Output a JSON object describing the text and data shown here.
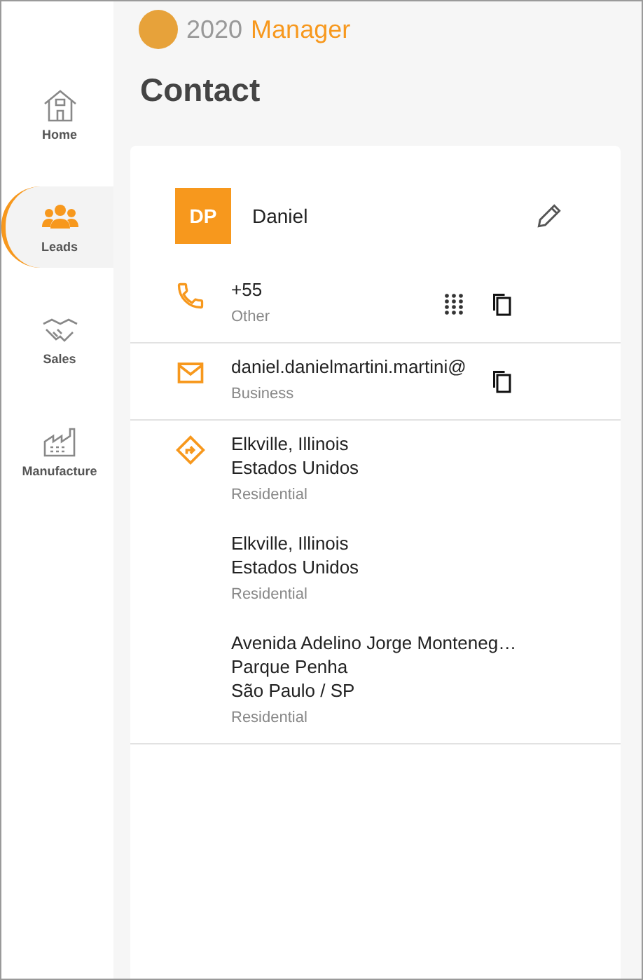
{
  "logo": {
    "word_1": "2020",
    "word_2": "Manager"
  },
  "nav": [
    {
      "label": "Home",
      "selected": false
    },
    {
      "label": "Leads",
      "selected": true
    },
    {
      "label": "Sales",
      "selected": false
    },
    {
      "label": "Manufacture",
      "selected": false
    }
  ],
  "title": "Contact",
  "contact": {
    "initials": "DP",
    "name": "Daniel"
  },
  "sections": [
    {
      "kind": "phone",
      "entries": [
        {
          "lines": [
            "+55"
          ],
          "type": "Other"
        }
      ]
    },
    {
      "kind": "email",
      "entries": [
        {
          "lines": [
            "daniel.danielmartini.martini@"
          ],
          "type": "Business"
        }
      ]
    },
    {
      "kind": "address",
      "entries": [
        {
          "lines": [
            "Elkville, Illinois",
            "Estados Unidos"
          ],
          "type": "Residential"
        },
        {
          "lines": [
            "Elkville, Illinois",
            "Estados Unidos"
          ],
          "type": "Residential"
        },
        {
          "lines": [
            "Avenida Adelino Jorge Monteneg…",
            "Parque Penha",
            "São Paulo / SP"
          ],
          "type": "Residential"
        }
      ]
    }
  ]
}
